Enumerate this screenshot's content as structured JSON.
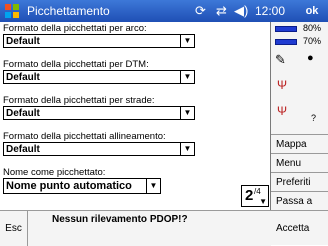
{
  "titlebar": {
    "app_title": "Picchettamento",
    "clock": "12:00",
    "ok_label": "ok",
    "sync_icon": "sync-icon",
    "signal_icon": "signal-icon",
    "volume_icon": "volume-icon"
  },
  "form": {
    "fields": [
      {
        "label": "Formato della picchettati per arco:",
        "value": "Default"
      },
      {
        "label": "Formato della picchettati per DTM:",
        "value": "Default"
      },
      {
        "label": "Formato della picchettati per strade:",
        "value": "Default"
      },
      {
        "label": "Formato della picchettati allineamento:",
        "value": "Default"
      },
      {
        "label": "Nome come picchettato:",
        "value": "Nome punto automatico"
      }
    ],
    "stepper": {
      "value": "2",
      "superscript": "/4"
    }
  },
  "side": {
    "battery": [
      {
        "text": "80%"
      },
      {
        "text": "70%"
      }
    ],
    "buttons": {
      "mappa": "Mappa",
      "menu": "Menu",
      "preferiti": "Preferiti",
      "passa": "Passa a"
    },
    "q_mark": "?"
  },
  "bottom": {
    "esc_label": "Esc",
    "status": "Nessun rilevamento PDOP!?",
    "accept_label": "Accetta"
  }
}
